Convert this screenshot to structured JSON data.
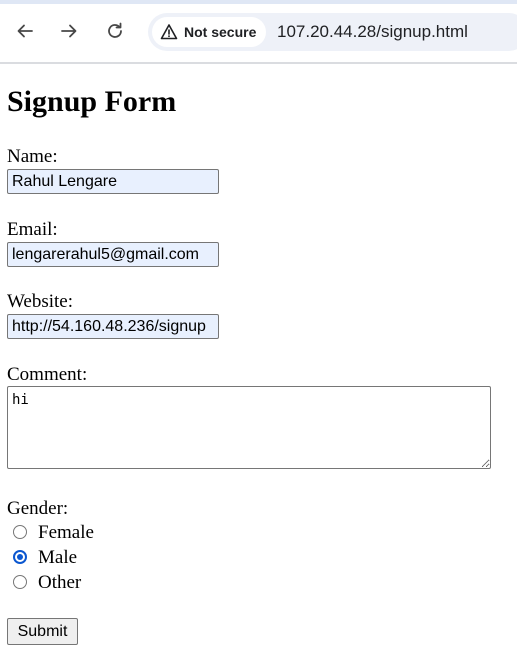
{
  "browser": {
    "security_label": "Not secure",
    "url": "107.20.44.28/signup.html"
  },
  "form": {
    "title": "Signup Form",
    "name_label": "Name:",
    "name_value": "Rahul Lengare",
    "email_label": "Email:",
    "email_value": "lengarerahul5@gmail.com",
    "website_label": "Website:",
    "website_value": "http://54.160.48.236/signup",
    "comment_label": "Comment:",
    "comment_value": "hi",
    "gender_label": "Gender:",
    "gender_options": [
      "Female",
      "Male",
      "Other"
    ],
    "gender_selected": "Male",
    "submit_label": "Submit"
  },
  "colors": {
    "autofill_bg": "#e8f0fe",
    "radio_accent": "#0b57d0",
    "omnibox_bg": "#eef1f8"
  }
}
